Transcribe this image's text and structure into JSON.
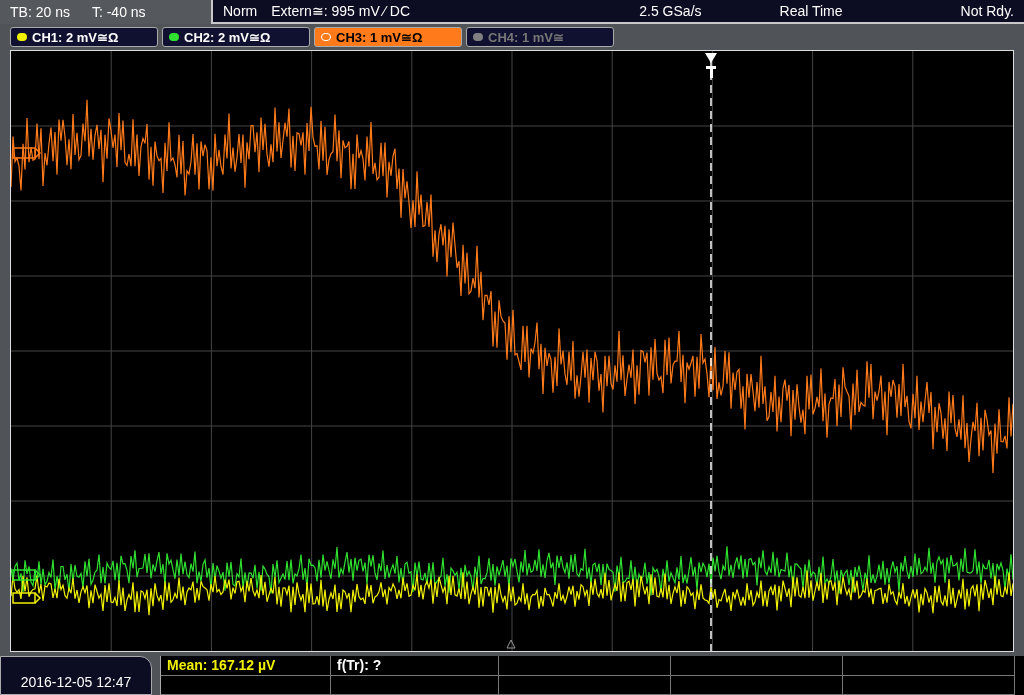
{
  "status": {
    "timebase": "TB: 20 ns",
    "trigger_offset": "T: -40 ns",
    "mode": "Norm",
    "trigger_source": "Extern≅: 995 mV ⁄ DC",
    "sample_rate": "2.5 GSa/s",
    "acquisition": "Real Time",
    "state": "Not Rdy."
  },
  "channels": [
    {
      "label": "CH1: 2 mV≅Ω",
      "color": "#f0f000",
      "selected": false,
      "enabled": true
    },
    {
      "label": "CH2: 2 mV≅Ω",
      "color": "#30e030",
      "selected": false,
      "enabled": true
    },
    {
      "label": "CH3: 1 mV≅Ω",
      "color": "#ff7a1a",
      "selected": true,
      "enabled": true
    },
    {
      "label": "CH4: 1 mV≅",
      "color": "#808080",
      "selected": false,
      "enabled": false
    }
  ],
  "datetime": "2016-12-05 12:47",
  "measurements": [
    {
      "text": "Mean: 167.12 µV",
      "kind": "channel"
    },
    {
      "text": "f(Tr): ?",
      "kind": "trigger"
    }
  ]
}
